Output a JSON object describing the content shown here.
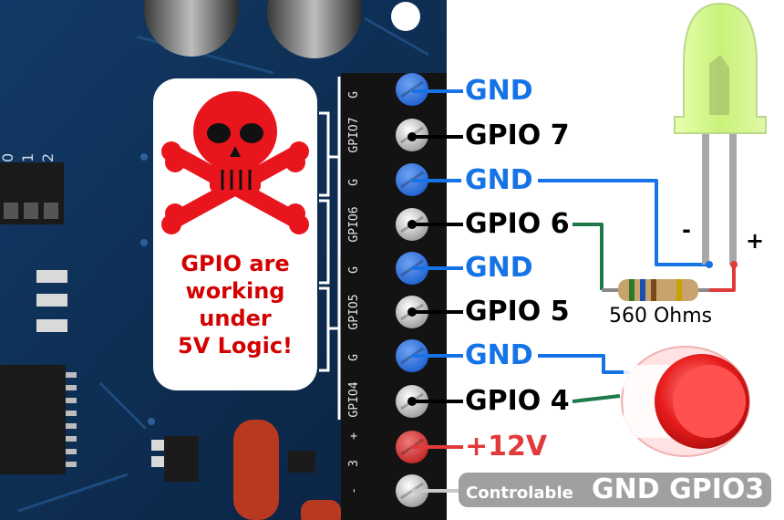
{
  "terminal_labels": [
    {
      "id": "gnd-1",
      "text": "GND",
      "color": "blue"
    },
    {
      "id": "gpio-7",
      "text": "GPIO 7",
      "color": "black"
    },
    {
      "id": "gnd-2",
      "text": "GND",
      "color": "blue"
    },
    {
      "id": "gpio-6",
      "text": "GPIO 6",
      "color": "black"
    },
    {
      "id": "gnd-3",
      "text": "GND",
      "color": "blue"
    },
    {
      "id": "gpio-5",
      "text": "GPIO 5",
      "color": "black"
    },
    {
      "id": "gnd-4",
      "text": "GND",
      "color": "blue"
    },
    {
      "id": "gpio-4",
      "text": "GPIO 4",
      "color": "black"
    },
    {
      "id": "plus-12v",
      "text": "+12V",
      "color": "red"
    }
  ],
  "pcb_silkscreen": [
    "G",
    "GPIO7",
    "G",
    "GPIO6",
    "G",
    "GPIO5",
    "G",
    "GPIO4",
    "+",
    "3",
    "-"
  ],
  "warning": {
    "line1": "GPIO are",
    "line2": "working",
    "line3": "under",
    "line4": "5V Logic!"
  },
  "resistor_label": "560 Ohms",
  "led": {
    "minus": "-",
    "plus": "+"
  },
  "gnd_gpio3": {
    "prefix": "Controlable",
    "name": "GND GPIO3"
  },
  "board_marks": [
    "0",
    "1",
    "2"
  ],
  "colors": {
    "gnd_wire": "#1673e6",
    "gpio_wire": "#000000",
    "signal_wire": "#1e7a4a",
    "power_wire": "#e03a3a",
    "gnd3_wire": "#c8c8c8",
    "pcb": "#0f2f55",
    "skull": "#e8161c"
  }
}
